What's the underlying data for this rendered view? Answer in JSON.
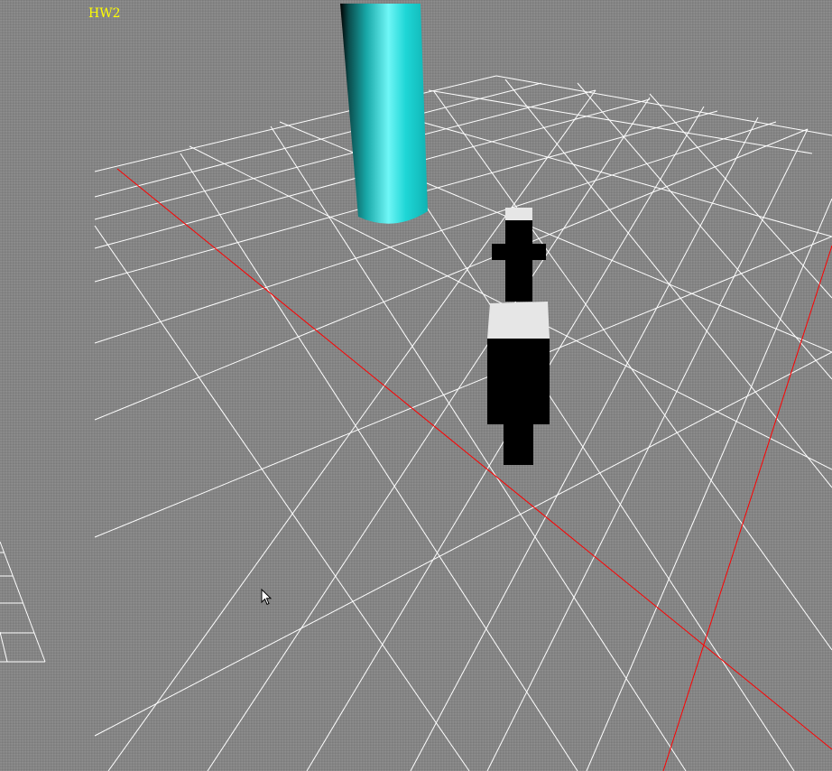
{
  "window": {
    "title": "HW2"
  },
  "scene": {
    "background_color": "#858585",
    "grid_color": "#ffffff",
    "axis_color": "#ff0000",
    "cylinder_color": "#00e0e0",
    "figure_colors": [
      "#000000",
      "#e6e6e6"
    ]
  },
  "hud": {
    "title_color": "#ffff00"
  },
  "cursor": {
    "icon": "arrow-pointer-icon"
  }
}
